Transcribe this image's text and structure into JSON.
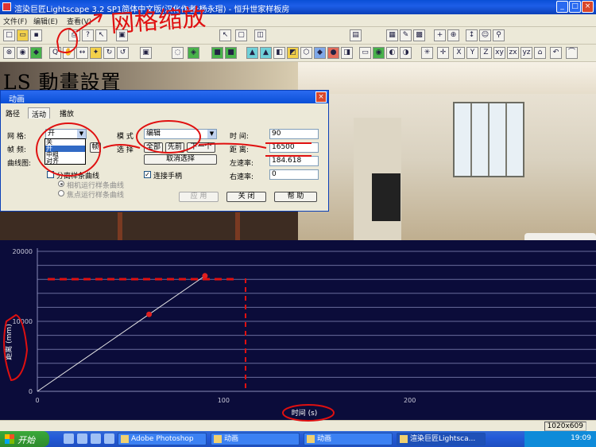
{
  "window": {
    "title": "渲染巨匠Lightscape 3.2 SP1简体中文版(汉化作者:杨永瑁) - 恒升世家样板房"
  },
  "menubar": [
    "文件(F)",
    "编辑(E)",
    "查看(V)"
  ],
  "annotations": {
    "top_scrawl": "网格缩放",
    "overlay_caption": "LS 動畫設置"
  },
  "dialog": {
    "title": "动画",
    "tabs": [
      "路径",
      "活动",
      "播放"
    ],
    "grid_label": "网 格:",
    "grid_value": "开",
    "grid_options": [
      "关",
      "开",
      "中粗",
      "对齐"
    ],
    "frame_label": "帧 频:",
    "curve_label": "曲线图:",
    "mode_label": "模 式",
    "mode_value": "编辑",
    "select_label": "选 择",
    "btn_all": "全部",
    "btn_first": "先前",
    "btn_next": "下一个",
    "btn_deselect": "取消选择",
    "time_label": "时 间:",
    "time_value": "90",
    "distance_label": "距 离:",
    "distance_value": "16500",
    "left_rate_label": "左速率:",
    "left_rate_value": "184.618",
    "right_rate_label": "右速率:",
    "right_rate_value": "0",
    "separate_curve": "分离样条曲线",
    "camera_curve": "相机运行样条曲线",
    "focus_curve": "焦点运行样条曲线",
    "connect_handle": "连接手柄",
    "btn_apply": "应 用",
    "btn_close": "关 闭",
    "btn_help": "帮 助"
  },
  "chart_data": {
    "type": "line",
    "xlabel": "时间 (s)",
    "ylabel": "距离 (mm)",
    "xlim": [
      0,
      300
    ],
    "ylim": [
      0,
      20000
    ],
    "xticks": [
      0,
      100,
      200
    ],
    "yticks": [
      0,
      10000,
      20000
    ],
    "series": [
      {
        "points": [
          [
            0,
            0
          ],
          [
            60,
            11000
          ],
          [
            90,
            16500
          ]
        ]
      }
    ],
    "keyframes": [
      [
        60,
        11000
      ],
      [
        90,
        16500
      ]
    ],
    "grid": "horizontal",
    "colors": {
      "background": "#0b0c3a",
      "line": "#e6e6e6",
      "keyframe": "#e02020",
      "gridline": "#6a6c9c"
    }
  },
  "status": {
    "resolution": "1020x609"
  },
  "taskbar": {
    "start": "开始",
    "tasks": [
      "Adobe Photoshop",
      "动画",
      "动画",
      "渲染巨匠Lightsca..."
    ],
    "clock": "19:09"
  }
}
